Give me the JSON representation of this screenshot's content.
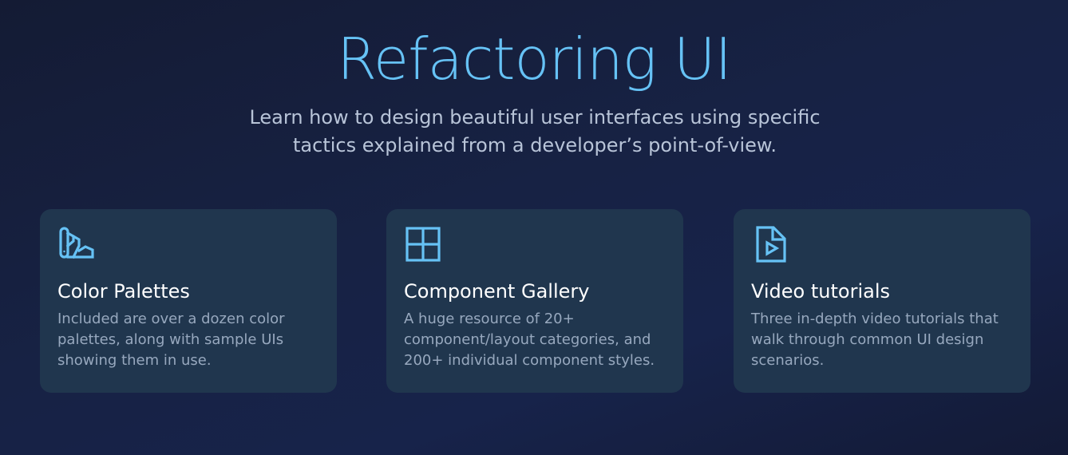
{
  "hero": {
    "title": "Refactoring UI",
    "subtitle": "Learn how to design beautiful user interfaces using specific tactics explained from a developer’s point-of-view."
  },
  "features": [
    {
      "icon": "swatch-book-icon",
      "title": "Color Palettes",
      "description": "Included are over a dozen color palettes, along with sample UIs showing them in use."
    },
    {
      "icon": "grid-layout-icon",
      "title": "Component Gallery",
      "description": "A huge resource of 20+ component/layout categories, and 200+ individual component styles."
    },
    {
      "icon": "video-file-icon",
      "title": "Video tutorials",
      "description": "Three in-depth video tutorials that walk through common UI design scenarios."
    }
  ],
  "colors": {
    "accent": "#66c2f5",
    "card_background": "#20364e",
    "page_background": "#172244"
  }
}
